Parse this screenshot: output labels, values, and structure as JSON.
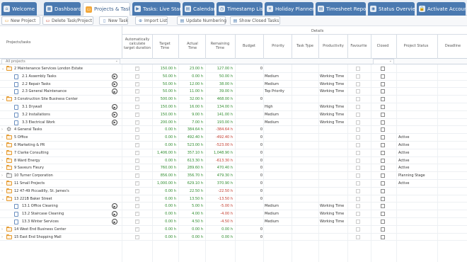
{
  "tabs": [
    {
      "label": "Welcome",
      "icon": "home-icon",
      "active": false
    },
    {
      "label": "Dashboard",
      "icon": "dashboard-icon",
      "active": false
    },
    {
      "label": "Projects & Tasks",
      "icon": "folder-icon",
      "active": true
    },
    {
      "label": "Tasks: Live Start",
      "icon": "play-icon",
      "active": false
    },
    {
      "label": "Calendar",
      "icon": "calendar-icon",
      "active": false
    },
    {
      "label": "Timestamp List",
      "icon": "clock-icon",
      "active": false
    },
    {
      "label": "Holiday Planner",
      "icon": "sun-icon",
      "active": false
    },
    {
      "label": "Timesheet Report",
      "icon": "report-icon",
      "active": false
    },
    {
      "label": "Status Overview",
      "icon": "status-icon",
      "active": false
    },
    {
      "label": "Activate Account",
      "icon": "lock-icon",
      "active": false
    }
  ],
  "toolbar": {
    "new_project": "New Project",
    "delete": "Delete Task/Project",
    "new_task": "New Task",
    "import_list": "Import List",
    "update_numbering": "Update Numbering",
    "show_closed": "Show Closed Tasks"
  },
  "header": {
    "projects_tasks": "Projects/tasks",
    "details": "Details",
    "auto_calc": "Automatically calculate target duration",
    "target_time": "Target Time",
    "actual_time": "Actual Time",
    "remaining_time": "Remaining Time",
    "budget": "Budget",
    "priority": "Priority",
    "task_type": "Task Type",
    "productivity": "Productivity",
    "favourite": "Favourite",
    "closed": "Closed",
    "project_status": "Project Status",
    "deadline": "Deadline"
  },
  "filter": {
    "projects_value": "All projects"
  },
  "rows": [
    {
      "kind": "project",
      "expanded": true,
      "name": "2 Maintenance Services London Estate",
      "target": "150.00 h",
      "actual": "23.00 h",
      "remaining": "127.00 h",
      "rem_color": "green",
      "budget": "0",
      "priority": "",
      "productivity": "",
      "status": "",
      "auto_tick": true
    },
    {
      "kind": "task",
      "name": "2.1 Assembly Tasks",
      "target": "50.00 h",
      "actual": "0.00 h",
      "remaining": "50.00 h",
      "rem_color": "green",
      "budget": "",
      "priority": "Medium",
      "productivity": "Working Time",
      "status": "",
      "auto_tick": true
    },
    {
      "kind": "task",
      "name": "2.2 Repair Tasks",
      "target": "50.00 h",
      "actual": "12.00 h",
      "remaining": "38.00 h",
      "rem_color": "green",
      "budget": "",
      "priority": "Medium",
      "productivity": "Working Time",
      "status": "",
      "auto_tick": true
    },
    {
      "kind": "task",
      "name": "2.3 General Maintenance",
      "target": "50.00 h",
      "actual": "11.00 h",
      "remaining": "39.00 h",
      "rem_color": "green",
      "budget": "",
      "priority": "Top Priority",
      "productivity": "Working Time",
      "status": "",
      "auto_tick": true
    },
    {
      "kind": "project",
      "expanded": true,
      "name": "3 Construction Site Business Center",
      "target": "500.00 h",
      "actual": "32.00 h",
      "remaining": "468.00 h",
      "rem_color": "green",
      "budget": "0",
      "priority": "",
      "productivity": "",
      "status": "",
      "auto_tick": true
    },
    {
      "kind": "task",
      "name": "3.1 Drywall",
      "target": "150.00 h",
      "actual": "16.00 h",
      "remaining": "134.00 h",
      "rem_color": "green",
      "budget": "",
      "priority": "High",
      "productivity": "Working Time",
      "status": "",
      "auto_tick": true
    },
    {
      "kind": "task",
      "name": "3.2 Installations",
      "target": "150.00 h",
      "actual": "9.00 h",
      "remaining": "141.00 h",
      "rem_color": "green",
      "budget": "",
      "priority": "Medium",
      "productivity": "Working Time",
      "status": "",
      "auto_tick": true
    },
    {
      "kind": "task",
      "name": "3.3 Electrical Work",
      "target": "200.00 h",
      "actual": "7.00 h",
      "remaining": "193.00 h",
      "rem_color": "green",
      "budget": "",
      "priority": "Medium",
      "productivity": "Working Time",
      "status": "",
      "auto_tick": true
    },
    {
      "kind": "general",
      "expanded": false,
      "name": "4 General Tasks",
      "target": "0.00 h",
      "actual": "384.64 h",
      "remaining": "-384.64 h",
      "rem_color": "red",
      "budget": "0",
      "priority": "",
      "productivity": "",
      "status": "",
      "auto_tick": true
    },
    {
      "kind": "project",
      "expanded": false,
      "name": "5 Office",
      "target": "0.00 h",
      "actual": "492.40 h",
      "remaining": "-492.40 h",
      "rem_color": "red",
      "budget": "0",
      "priority": "",
      "productivity": "",
      "status": "Active",
      "auto_tick": true
    },
    {
      "kind": "project",
      "expanded": false,
      "name": "6 Marketing & PR",
      "target": "0.00 h",
      "actual": "523.00 h",
      "remaining": "-523.00 h",
      "rem_color": "red",
      "budget": "0",
      "priority": "",
      "productivity": "",
      "status": "Active",
      "auto_tick": true
    },
    {
      "kind": "project",
      "expanded": false,
      "name": "7 Clarke Consulting",
      "target": "1,406.00 h",
      "actual": "357.10 h",
      "remaining": "1,048.90 h",
      "rem_color": "green",
      "budget": "0",
      "priority": "",
      "productivity": "",
      "status": "Active",
      "auto_tick": true
    },
    {
      "kind": "project",
      "expanded": false,
      "name": "8 Ward Energy",
      "target": "0.00 h",
      "actual": "613.30 h",
      "remaining": "-613.30 h",
      "rem_color": "red",
      "budget": "0",
      "priority": "",
      "productivity": "",
      "status": "Active",
      "auto_tick": true
    },
    {
      "kind": "project",
      "expanded": false,
      "name": "9 Saveurs Fleury",
      "target": "760.00 h",
      "actual": "289.60 h",
      "remaining": "470.40 h",
      "rem_color": "green",
      "budget": "0",
      "priority": "",
      "productivity": "",
      "status": "Active",
      "auto_tick": true
    },
    {
      "kind": "grey",
      "expanded": false,
      "name": "10 Turner Corporation",
      "target": "856.00 h",
      "actual": "356.70 h",
      "remaining": "479.30 h",
      "rem_color": "green",
      "budget": "0",
      "priority": "",
      "productivity": "",
      "status": "Planning Stage",
      "auto_tick": true
    },
    {
      "kind": "project",
      "expanded": false,
      "name": "11 Small Projects",
      "target": "1,000.00 h",
      "actual": "629.10 h",
      "remaining": "370.90 h",
      "rem_color": "green",
      "budget": "0",
      "priority": "",
      "productivity": "",
      "status": "Active",
      "auto_tick": true
    },
    {
      "kind": "project",
      "expanded": false,
      "name": "12 47-49 Piccadilly, St. James's",
      "target": "0.00 h",
      "actual": "22.50 h",
      "remaining": "-22.50 h",
      "rem_color": "red",
      "budget": "0",
      "priority": "",
      "productivity": "",
      "status": "",
      "auto_tick": true
    },
    {
      "kind": "project",
      "expanded": true,
      "name": "13 221B Baker Street",
      "target": "0.00 h",
      "actual": "13.50 h",
      "remaining": "-13.50 h",
      "rem_color": "red",
      "budget": "0",
      "priority": "",
      "productivity": "",
      "status": "",
      "auto_tick": true
    },
    {
      "kind": "task",
      "name": "13.1 Office Cleaning",
      "target": "0.00 h",
      "actual": "5.00 h",
      "remaining": "-5.00 h",
      "rem_color": "red",
      "budget": "",
      "priority": "Medium",
      "productivity": "Working Time",
      "status": "",
      "auto_tick": true
    },
    {
      "kind": "task",
      "name": "13.2 Staircase Cleaning",
      "target": "0.00 h",
      "actual": "4.00 h",
      "remaining": "-4.00 h",
      "rem_color": "red",
      "budget": "",
      "priority": "Medium",
      "productivity": "Working Time",
      "status": "",
      "auto_tick": true
    },
    {
      "kind": "task",
      "name": "13.3 Winter Services",
      "target": "0.00 h",
      "actual": "4.50 h",
      "remaining": "-4.50 h",
      "rem_color": "red",
      "budget": "",
      "priority": "Medium",
      "productivity": "Working Time",
      "status": "",
      "auto_tick": true
    },
    {
      "kind": "project",
      "expanded": false,
      "name": "14 West End Business Center",
      "target": "0.00 h",
      "actual": "0.00 h",
      "remaining": "0.00 h",
      "rem_color": "green",
      "budget": "0",
      "priority": "",
      "productivity": "",
      "status": "",
      "auto_tick": true
    },
    {
      "kind": "project",
      "expanded": false,
      "name": "15 East End Shopping Mall",
      "target": "0.00 h",
      "actual": "0.00 h",
      "remaining": "0.00 h",
      "rem_color": "green",
      "budget": "0",
      "priority": "",
      "productivity": "",
      "status": "",
      "auto_tick": true
    }
  ],
  "colors": {
    "tab_blue": "#4a79b0",
    "folder_orange": "#e59a2f",
    "positive_green": "#2e8b2e",
    "negative_red": "#c0392b"
  }
}
